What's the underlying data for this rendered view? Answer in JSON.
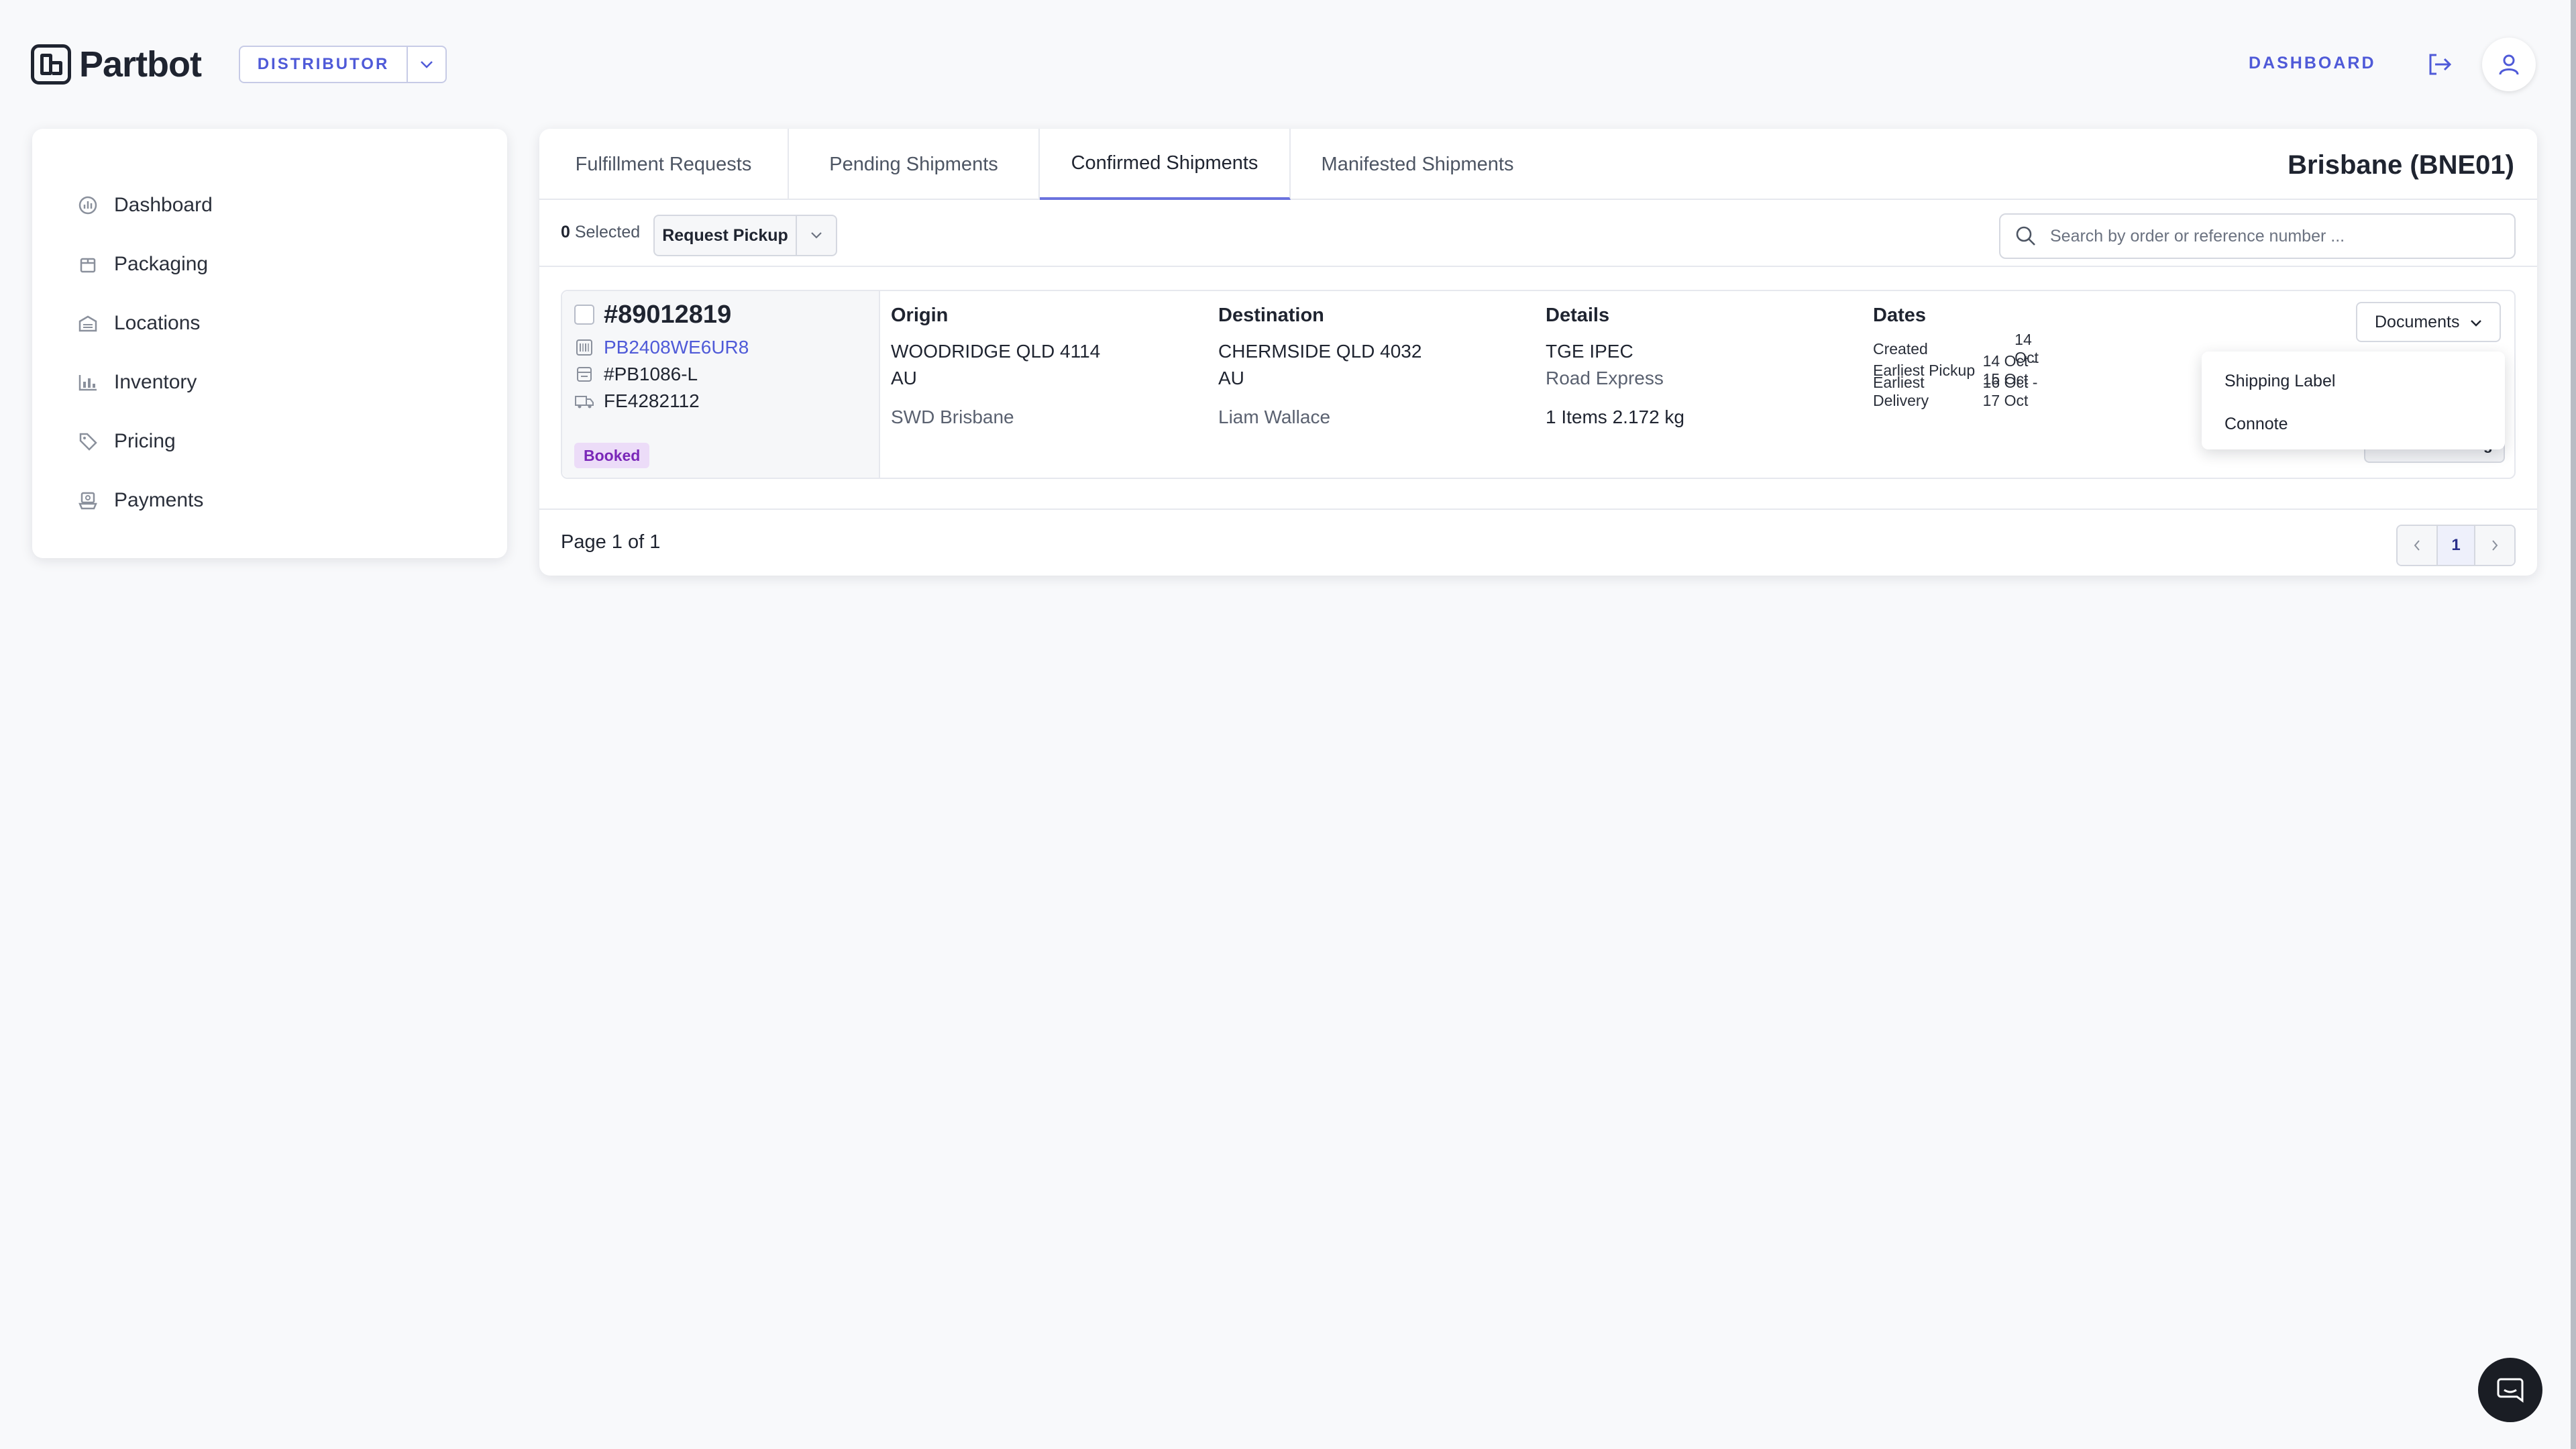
{
  "header": {
    "logo_text": "Partbot",
    "role_selector": "DISTRIBUTOR",
    "dashboard_link": "DASHBOARD"
  },
  "sidebar": {
    "items": [
      {
        "label": "Dashboard",
        "icon": "dashboard-icon"
      },
      {
        "label": "Packaging",
        "icon": "package-icon"
      },
      {
        "label": "Locations",
        "icon": "warehouse-icon"
      },
      {
        "label": "Inventory",
        "icon": "inventory-chart-icon"
      },
      {
        "label": "Pricing",
        "icon": "tag-icon"
      },
      {
        "label": "Payments",
        "icon": "payments-icon"
      }
    ]
  },
  "tabs": [
    {
      "label": "Fulfillment Requests",
      "active": false
    },
    {
      "label": "Pending Shipments",
      "active": false
    },
    {
      "label": "Confirmed Shipments",
      "active": true
    },
    {
      "label": "Manifested Shipments",
      "active": false
    }
  ],
  "location": "Brisbane (BNE01)",
  "toolbar": {
    "selected_count": "0",
    "selected_suffix": " Selected",
    "request_pickup": "Request Pickup",
    "search_placeholder": "Search by order or reference number ..."
  },
  "shipment": {
    "order_number": "#89012819",
    "refs": [
      "PB2408WE6UR8",
      "#PB1086-L",
      "FE4282112"
    ],
    "status": "Booked",
    "origin": {
      "heading": "Origin",
      "line1": "WOODRIDGE QLD 4114",
      "line2": "AU",
      "name": "SWD Brisbane"
    },
    "destination": {
      "heading": "Destination",
      "line1": "CHERMSIDE QLD 4032",
      "line2": "AU",
      "name": "Liam Wallace"
    },
    "details": {
      "heading": "Details",
      "carrier": "TGE IPEC",
      "service": "Road Express",
      "summary": "1 Items 2.172 kg"
    },
    "dates": {
      "heading": "Dates",
      "rows": [
        {
          "label": "Created",
          "value": "14 Oct"
        },
        {
          "label": "Earliest Pickup",
          "value": "14 Oct - 15 Oct"
        },
        {
          "label": "Earliest Delivery",
          "value": "16 Oct - 17 Oct"
        }
      ]
    },
    "documents_button": "Documents",
    "cancel_button": "Cancel Booking",
    "documents_menu": [
      "Shipping Label",
      "Connote"
    ]
  },
  "pagination": {
    "label": "Page 1 of 1",
    "current": "1"
  },
  "colors": {
    "accent": "#4f5ad8",
    "tab_underline": "#6a72de",
    "badge_bg": "#ecdcf8",
    "badge_text": "#7a27b8"
  }
}
